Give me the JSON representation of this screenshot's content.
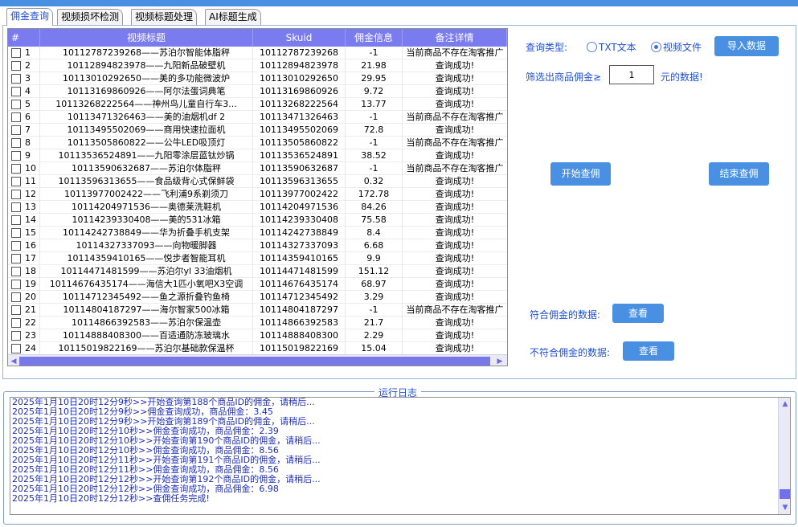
{
  "tabs": [
    {
      "label": "佣金查询",
      "active": true
    },
    {
      "label": "视频损坏检测",
      "active": false
    },
    {
      "label": "视频标题处理",
      "active": false
    },
    {
      "label": "AI标题生成",
      "active": false
    }
  ],
  "table": {
    "headers": [
      "#",
      "视频标题",
      "Skuid",
      "佣金信息",
      "备注详情"
    ],
    "rows": [
      {
        "num": "1",
        "title": "10112787239268——苏泊尔智能体脂秤",
        "skuid": "10112787239268",
        "commission": "-1",
        "note": "当前商品不存在淘客推广"
      },
      {
        "num": "2",
        "title": "10112894823978——九阳新品破壁机",
        "skuid": "10112894823978",
        "commission": "21.98",
        "note": "查询成功!"
      },
      {
        "num": "3",
        "title": "10113010292650——美的多功能微波炉",
        "skuid": "10113010292650",
        "commission": "29.95",
        "note": "查询成功!"
      },
      {
        "num": "4",
        "title": "10113169860926——阿尔法蛋词典笔",
        "skuid": "10113169860926",
        "commission": "9.72",
        "note": "查询成功!"
      },
      {
        "num": "5",
        "title": "10113268222564——神州鸟儿童自行车3...",
        "skuid": "10113268222564",
        "commission": "13.77",
        "note": "查询成功!"
      },
      {
        "num": "6",
        "title": "10113471326463——美的油烟机df 2",
        "skuid": "10113471326463",
        "commission": "-1",
        "note": "当前商品不存在淘客推广"
      },
      {
        "num": "7",
        "title": "10113495502069——商用快速拉面机",
        "skuid": "10113495502069",
        "commission": "72.8",
        "note": "查询成功!"
      },
      {
        "num": "8",
        "title": "10113505860822——公牛LED吸顶灯",
        "skuid": "10113505860822",
        "commission": "-1",
        "note": "当前商品不存在淘客推广"
      },
      {
        "num": "9",
        "title": "10113536524891——九阳零涂层蓝钛炒锅",
        "skuid": "10113536524891",
        "commission": "38.52",
        "note": "查询成功!"
      },
      {
        "num": "10",
        "title": "10113590632687——苏泊尔体脂秤",
        "skuid": "10113590632687",
        "commission": "-1",
        "note": "当前商品不存在淘客推广"
      },
      {
        "num": "11",
        "title": "10113596313655——食品级背心式保鲜袋",
        "skuid": "10113596313655",
        "commission": "0.32",
        "note": "查询成功!"
      },
      {
        "num": "12",
        "title": "10113977002422——飞利浦9系剃须刀",
        "skuid": "10113977002422",
        "commission": "172.78",
        "note": "查询成功!"
      },
      {
        "num": "13",
        "title": "10114204971536——奥德莱洗鞋机",
        "skuid": "10114204971536",
        "commission": "84.26",
        "note": "查询成功!"
      },
      {
        "num": "14",
        "title": "10114239330408——美的531冰箱",
        "skuid": "10114239330408",
        "commission": "75.58",
        "note": "查询成功!"
      },
      {
        "num": "15",
        "title": "10114242738849——华为折叠手机支架",
        "skuid": "10114242738849",
        "commission": "8.4",
        "note": "查询成功!"
      },
      {
        "num": "16",
        "title": "10114327337093——向物暖脚器",
        "skuid": "10114327337093",
        "commission": "6.68",
        "note": "查询成功!"
      },
      {
        "num": "17",
        "title": "10114359410165——悦步者智能耳机",
        "skuid": "10114359410165",
        "commission": "9.9",
        "note": "查询成功!"
      },
      {
        "num": "18",
        "title": "10114471481599——苏泊尔yl 33油烟机",
        "skuid": "10114471481599",
        "commission": "151.12",
        "note": "查询成功!"
      },
      {
        "num": "19",
        "title": "10114676435174——海信大1匹小氧吧X3空调",
        "skuid": "10114676435174",
        "commission": "68.97",
        "note": "查询成功!"
      },
      {
        "num": "20",
        "title": "10114712345492——鱼之源折叠钓鱼椅",
        "skuid": "10114712345492",
        "commission": "3.29",
        "note": "查询成功!"
      },
      {
        "num": "21",
        "title": "10114804187297——海尔智家500冰箱",
        "skuid": "10114804187297",
        "commission": "-1",
        "note": "当前商品不存在淘客推广"
      },
      {
        "num": "22",
        "title": "10114866392583——苏泊尔保温壶",
        "skuid": "10114866392583",
        "commission": "21.7",
        "note": "查询成功!"
      },
      {
        "num": "23",
        "title": "10114888408300——百适通防冻玻璃水",
        "skuid": "10114888408300",
        "commission": "2.29",
        "note": "查询成功!"
      },
      {
        "num": "24",
        "title": "10115019822169——苏泊尔基础款保温杯",
        "skuid": "10115019822169",
        "commission": "15.04",
        "note": "查询成功!"
      }
    ]
  },
  "query": {
    "type_label": "查询类型:",
    "radio_txt": "TXT文本",
    "radio_video": "视频文件",
    "selected": "视频文件",
    "import_button": "导入数据",
    "filter_prefix": "筛选出商品佣金≥",
    "filter_value": "1",
    "filter_suffix": "元的数据!",
    "start_button": "开始查佣",
    "end_button": "结束查佣",
    "match_label": "符合佣金的数据:",
    "match_button": "查看",
    "nomatch_label": "不符合佣金的数据:",
    "nomatch_button": "查看"
  },
  "log": {
    "title": "运行日志",
    "lines": [
      "2025年1月10日20时12分9秒>>开始查询第188个商品ID的佣金，请稍后...",
      "2025年1月10日20时12分9秒>>佣金查询成功，商品佣金：3.45",
      "2025年1月10日20时12分9秒>>开始查询第189个商品ID的佣金，请稍后...",
      "2025年1月10日20时12分10秒>>佣金查询成功，商品佣金：2.39",
      "2025年1月10日20时12分10秒>>开始查询第190个商品ID的佣金，请稍后...",
      "2025年1月10日20时12分10秒>>佣金查询成功，商品佣金：8.56",
      "2025年1月10日20时12分11秒>>开始查询第191个商品ID的佣金，请稍后...",
      "2025年1月10日20时12分11秒>>佣金查询成功，商品佣金：8.56",
      "2025年1月10日20时12分12秒>>开始查询第192个商品ID的佣金，请稍后...",
      "2025年1月10日20时12分12秒>>佣金查询成功，商品佣金：6.98",
      "2025年1月10日20时12分12秒>>查佣任务完成!"
    ]
  },
  "colors": {
    "accent": "#4a90e2",
    "table_header": "#7b7bf0",
    "label_blue": "#1f4fd8",
    "log_text": "#1e2eb8"
  }
}
